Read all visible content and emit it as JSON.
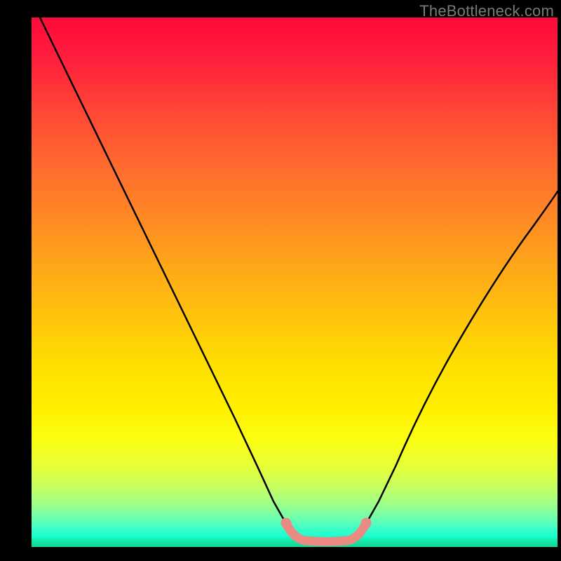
{
  "watermark": "TheBottleneck.com",
  "chart_data": {
    "type": "line",
    "title": "",
    "xlabel": "",
    "ylabel": "",
    "xlim": [
      0,
      1
    ],
    "ylim": [
      0,
      1
    ],
    "series": [
      {
        "name": "bottleneck-curve",
        "x": [
          0.0,
          0.05,
          0.1,
          0.15,
          0.2,
          0.25,
          0.3,
          0.35,
          0.4,
          0.45,
          0.475,
          0.5,
          0.525,
          0.55,
          0.575,
          0.6,
          0.625,
          0.65,
          0.7,
          0.75,
          0.8,
          0.85,
          0.9,
          0.95,
          1.0
        ],
        "y": [
          1.0,
          0.9,
          0.8,
          0.7,
          0.6,
          0.5,
          0.4,
          0.3,
          0.2,
          0.1,
          0.05,
          0.02,
          0.01,
          0.01,
          0.01,
          0.02,
          0.04,
          0.08,
          0.16,
          0.24,
          0.32,
          0.4,
          0.46,
          0.52,
          0.57
        ]
      },
      {
        "name": "flat-zone-highlight",
        "x": [
          0.5,
          0.525,
          0.55,
          0.575,
          0.6
        ],
        "y": [
          0.02,
          0.01,
          0.01,
          0.01,
          0.02
        ]
      }
    ],
    "gradient_stops": [
      {
        "pos": 0.0,
        "color": "#ff0a3a"
      },
      {
        "pos": 0.5,
        "color": "#ffc400"
      },
      {
        "pos": 0.8,
        "color": "#f5ff20"
      },
      {
        "pos": 1.0,
        "color": "#14d898"
      }
    ]
  }
}
